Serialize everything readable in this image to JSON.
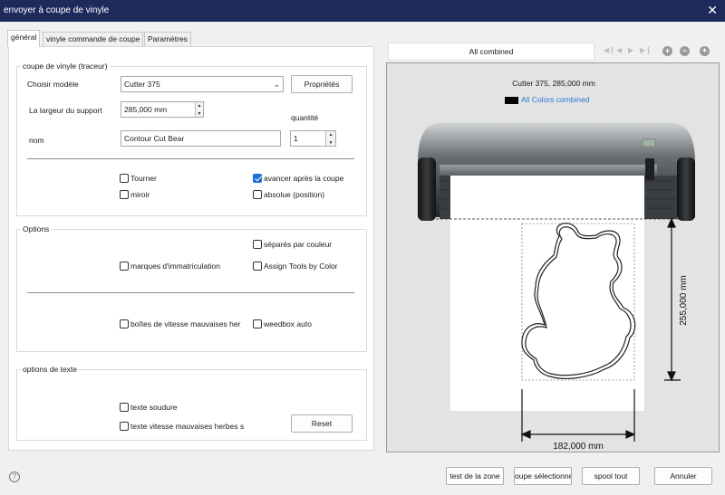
{
  "window": {
    "title": "envoyer à coupe de vinyle",
    "close_symbol": "✕"
  },
  "tabs": [
    {
      "label": "général",
      "active": true
    },
    {
      "label": "vinyle commande de coupe",
      "active": false
    },
    {
      "label": "Paramètres",
      "active": false
    }
  ],
  "group_cutter": {
    "title": "coupe de vinyle (traceur)",
    "model_label": "Choisir modèle",
    "model_value": "Cutter 375",
    "properties_button": "Propriétés",
    "width_label": "La largeur du support",
    "width_value": "285,000 mm",
    "quantity_label": "quantité",
    "quantity_value": "1",
    "name_label": "nom",
    "name_value": "Contour Cut Bear",
    "checkboxes": {
      "rotate": {
        "label": "Tourner",
        "checked": false
      },
      "mirror": {
        "label": "miroir",
        "checked": false
      },
      "advance": {
        "label": "avancer après la coupe",
        "checked": true
      },
      "absolute": {
        "label": "absolue (position)",
        "checked": false
      }
    }
  },
  "group_options": {
    "title": "Options",
    "checkboxes": {
      "separate_by_color": {
        "label": "séparés par couleur",
        "checked": false
      },
      "registration_marks": {
        "label": "marques d'immatriculation",
        "checked": false
      },
      "assign_tools": {
        "label": "Assign Tools by Color",
        "checked": false
      },
      "weed_boxes": {
        "label": "boîtes de vitesse mauvaises her",
        "checked": false
      },
      "weedbox_auto": {
        "label": "weedbox auto",
        "checked": false
      }
    }
  },
  "group_text": {
    "title": "options de texte",
    "checkboxes": {
      "weld_text": {
        "label": "texte soudure",
        "checked": false
      },
      "weed_text": {
        "label": "texte vitesse mauvaises herbes s",
        "checked": false
      }
    },
    "reset_button": "Reset"
  },
  "preview": {
    "toolbar_title": "All combined",
    "nav_icons": [
      "first-page-icon",
      "previous-page-icon",
      "next-page-icon",
      "last-page-icon"
    ],
    "zoom_icons": [
      "zoom-in-icon",
      "zoom-out-icon",
      "zoom-fit-icon"
    ],
    "cutter_info": "Cutter 375,  285,000 mm",
    "color_legend_label": "All Colors combined",
    "color_legend_swatch": "#000000",
    "accent_color": "#2a7ad4",
    "height_dimension": "255,000 mm",
    "width_dimension": "182,000 mm"
  },
  "footer": {
    "test_area_button": "test de la zone",
    "spool_selected_button": "oupe sélectionné",
    "spool_all_button": "spool tout",
    "cancel_button": "Annuler",
    "help_symbol": "?"
  }
}
